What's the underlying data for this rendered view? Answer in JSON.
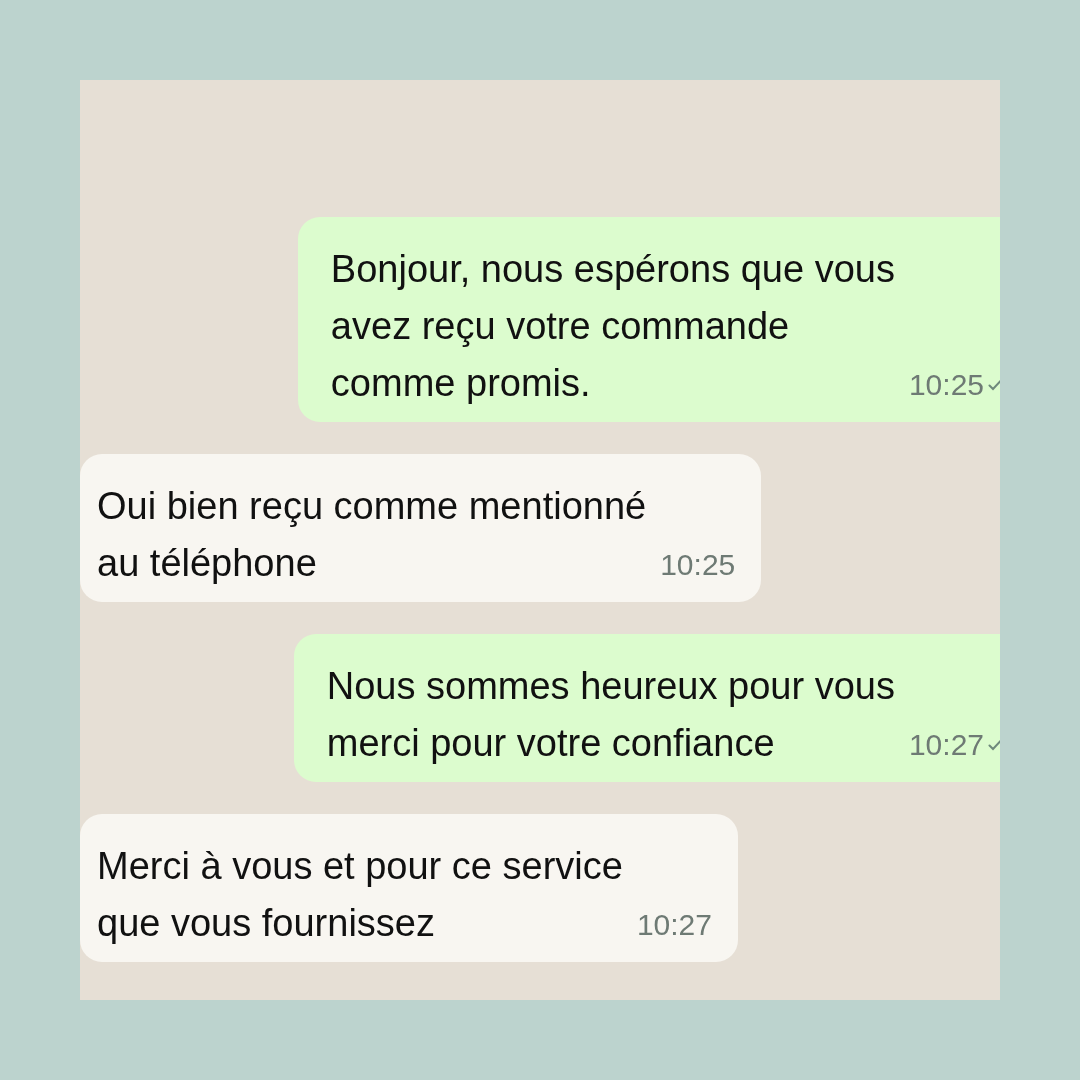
{
  "messages": [
    {
      "kind": "sent",
      "text": "Bonjour, nous espérons que vous\navez reçu votre commande\ncomme promis.",
      "time": "10:25"
    },
    {
      "kind": "received",
      "text": "Oui bien reçu comme mentionné\nau téléphone",
      "time": "10:25"
    },
    {
      "kind": "sent",
      "text": "Nous sommes heureux pour vous\nmerci pour votre confiance",
      "time": "10:27"
    },
    {
      "kind": "received",
      "text": "Merci à vous et pour ce service\nque vous fournissez",
      "time": "10:27"
    }
  ]
}
